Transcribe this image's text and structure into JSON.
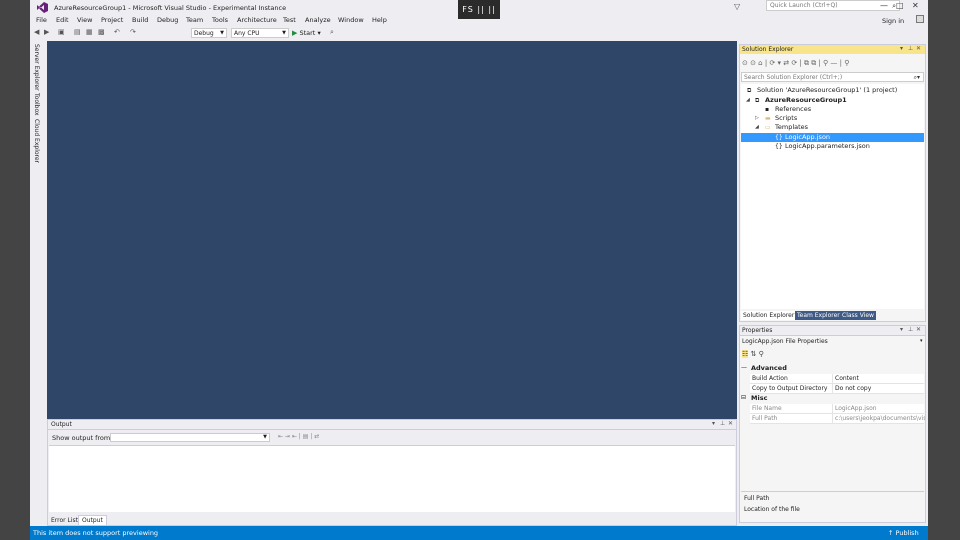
{
  "window": {
    "title": "AzureResourceGroup1 - Microsoft Visual Studio - Experimental Instance",
    "recording_badge": "FS  ||  ||",
    "quick_launch_placeholder": "Quick Launch (Ctrl+Q)",
    "sign_in": "Sign in",
    "controls": [
      "—",
      "□",
      "✕"
    ]
  },
  "menu": [
    "File",
    "Edit",
    "View",
    "Project",
    "Build",
    "Debug",
    "Team",
    "Tools",
    "Architecture",
    "Test",
    "Analyze",
    "Window",
    "Help"
  ],
  "toolbar": {
    "configuration": "Debug",
    "platform": "Any CPU",
    "start_label": "Start"
  },
  "left_tabs": [
    "Server Explorer",
    "Toolbox",
    "Cloud Explorer"
  ],
  "output": {
    "title": "Output",
    "show_output_from_label": "Show output from:",
    "source_value": "",
    "tabs": [
      "Error List",
      "Output"
    ],
    "active_tab": "Output"
  },
  "solution_explorer": {
    "title": "Solution Explorer",
    "search_placeholder": "Search Solution Explorer (Ctrl+;)",
    "tree": [
      {
        "label": "Solution 'AzureResourceGroup1' (1 project)",
        "icon": "solution-icon",
        "level": 0,
        "expander": ""
      },
      {
        "label": "AzureResourceGroup1",
        "icon": "project-icon",
        "level": 1,
        "expander": "◢",
        "bold": true
      },
      {
        "label": "References",
        "icon": "references-icon",
        "level": 2,
        "expander": ""
      },
      {
        "label": "Scripts",
        "icon": "folder-icon",
        "level": 2,
        "expander": "▷"
      },
      {
        "label": "Templates",
        "icon": "folder-open-icon",
        "level": 2,
        "expander": "◢"
      },
      {
        "label": "LogicApp.json",
        "icon": "json-file-icon",
        "level": 3,
        "expander": "",
        "selected": true
      },
      {
        "label": "LogicApp.parameters.json",
        "icon": "json-file-icon",
        "level": 3,
        "expander": ""
      }
    ],
    "tabs": [
      "Solution Explorer",
      "Team Explorer",
      "Class View"
    ],
    "active_tab": "Solution Explorer"
  },
  "properties": {
    "title": "Properties",
    "object": "LogicApp.json  File Properties",
    "categories": [
      {
        "name": "Advanced",
        "rows": [
          {
            "name": "Build Action",
            "value": "Content",
            "dim": false
          },
          {
            "name": "Copy to Output Directory",
            "value": "Do not copy",
            "dim": false
          }
        ]
      },
      {
        "name": "Misc",
        "rows": [
          {
            "name": "File Name",
            "value": "LogicApp.json",
            "dim": true
          },
          {
            "name": "Full Path",
            "value": "c:\\users\\jeokpa\\documents\\vis",
            "dim": true
          }
        ]
      }
    ],
    "description_title": "Full Path",
    "description_text": "Location of the file"
  },
  "status": {
    "text": "This item does not support previewing",
    "publish": "Publish"
  },
  "colors": {
    "editor_background": "#2f4668",
    "status_bar": "#007acc",
    "selection": "#3399ff",
    "active_tool_window_header": "#f7e48b"
  }
}
